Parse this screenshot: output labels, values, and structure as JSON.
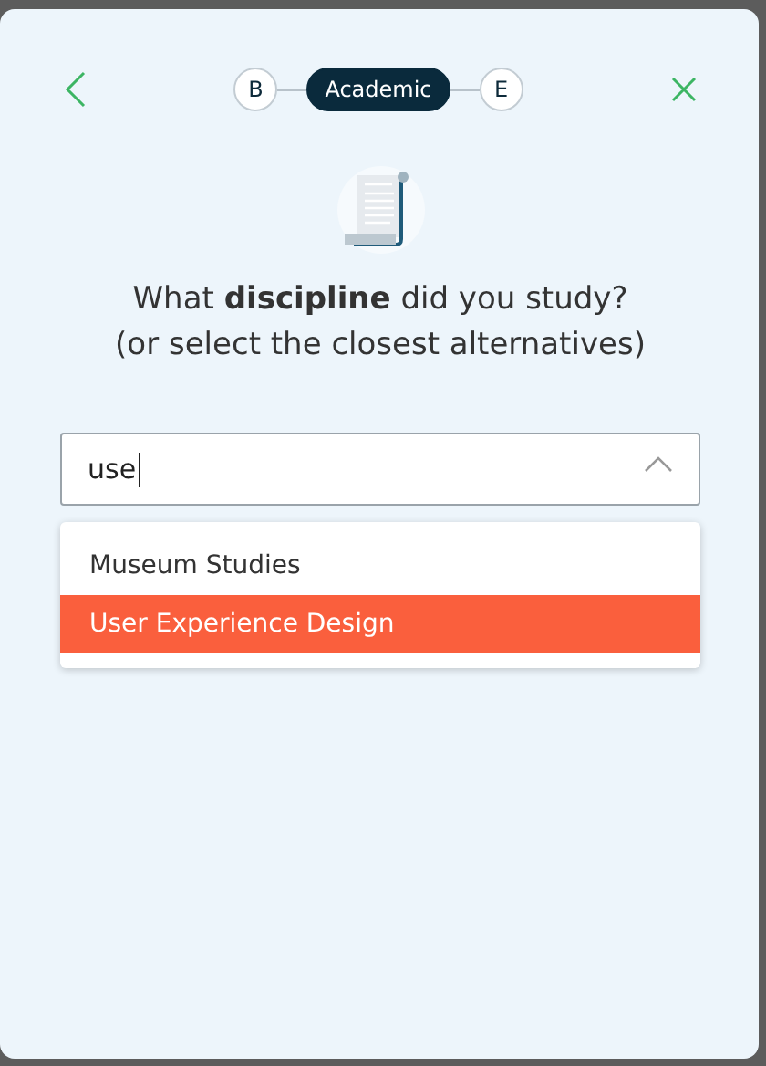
{
  "steps": [
    {
      "label": "B",
      "selected": false
    },
    {
      "label": "Academic",
      "selected": true
    },
    {
      "label": "E",
      "selected": false
    }
  ],
  "question": "What **discipline** did you study?",
  "hint": "(or select the closest alternatives)",
  "search": {
    "value": "use",
    "expanded": true
  },
  "options": [
    {
      "label": "Museum Studies",
      "selected": false
    },
    {
      "label": "User Experience Design",
      "selected": true
    }
  ]
}
